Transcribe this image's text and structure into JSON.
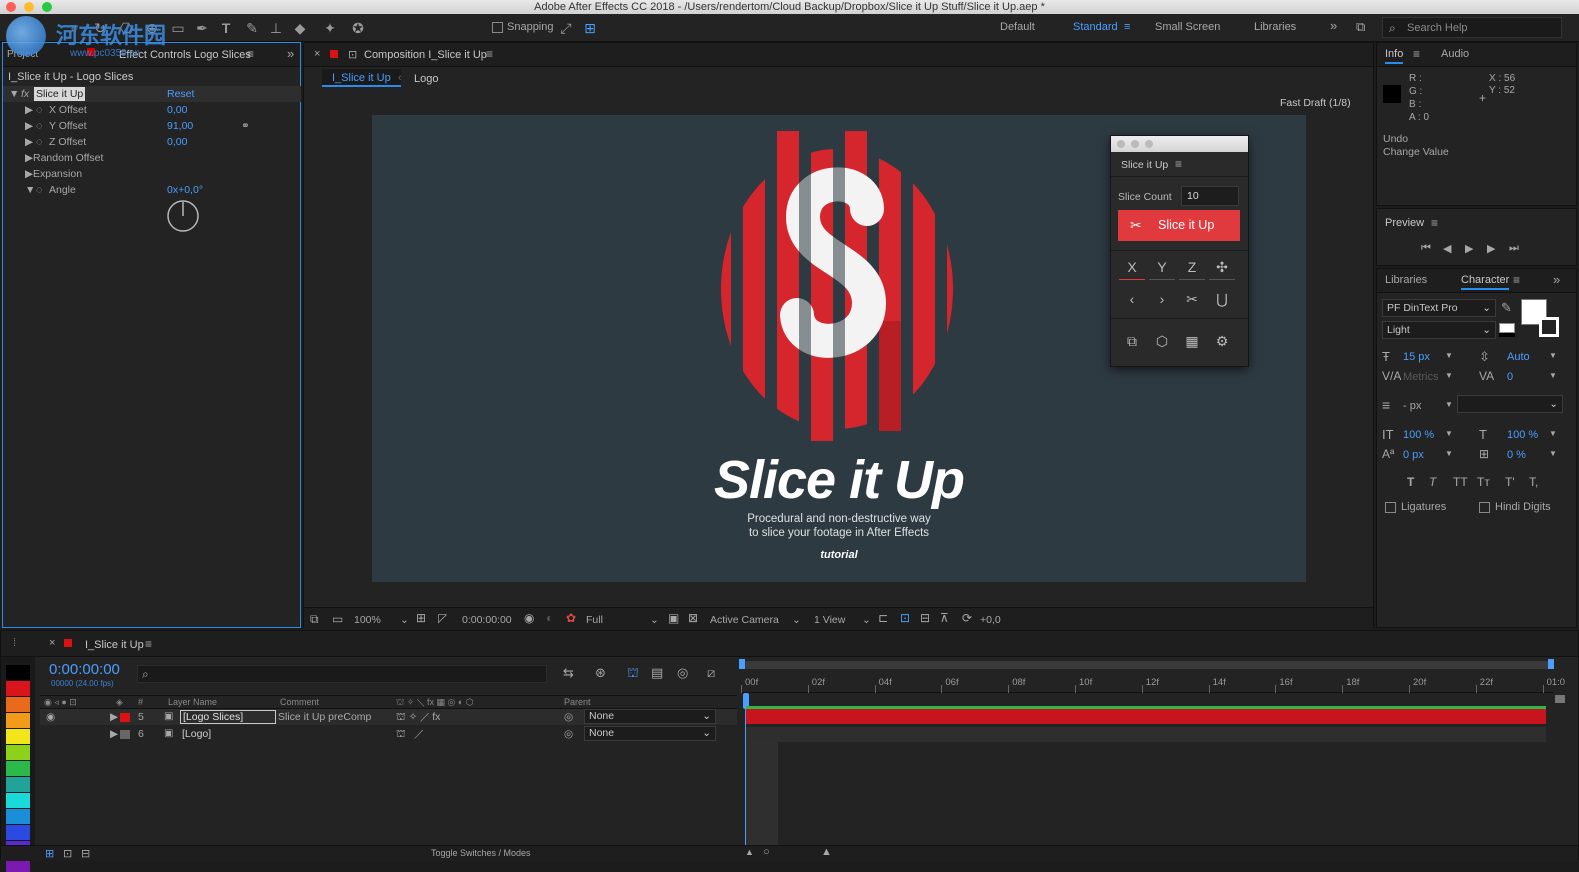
{
  "window": {
    "title": "Adobe After Effects CC 2018 - /Users/rendertom/Cloud Backup/Dropbox/Slice it Up Stuff/Slice it Up.aep *"
  },
  "watermark": {
    "text": "河东软件园",
    "sub": "www.pc0359.cn"
  },
  "toolbar": {
    "snapping_label": "Snapping",
    "workspaces": [
      "Default",
      "Standard",
      "Small Screen",
      "Libraries"
    ],
    "active_workspace": "Standard",
    "search_placeholder": "Search Help"
  },
  "project_tab": "Project",
  "effect_controls": {
    "tab_title": "Effect Controls Logo Slices",
    "layer_path": "I_Slice it Up - Logo Slices",
    "effect_name": "Slice it Up",
    "reset_label": "Reset",
    "properties": [
      {
        "name": "X Offset",
        "value": "0,00"
      },
      {
        "name": "Y Offset",
        "value": "91,00"
      },
      {
        "name": "Z Offset",
        "value": "0,00"
      },
      {
        "name": "Random Offset",
        "value": ""
      },
      {
        "name": "Expansion",
        "value": ""
      },
      {
        "name": "Angle",
        "value": "0x+0,0°"
      }
    ]
  },
  "composition": {
    "tab_title": "Composition I_Slice it Up",
    "breadcrumb": [
      "I_Slice it Up",
      "Logo"
    ],
    "render_mode": "Fast Draft (1/8)",
    "logo_title": "Slice it Up",
    "logo_subtitle_1": "Procedural and non-destructive way",
    "logo_subtitle_2": "to slice your footage in After Effects",
    "logo_tag": "tutorial",
    "footer": {
      "zoom": "100%",
      "timecode": "0:00:00:00",
      "resolution": "Full",
      "camera": "Active Camera",
      "views": "1 View",
      "exposure": "+0,0"
    }
  },
  "plugin_panel": {
    "title": "Slice it Up",
    "slice_count_label": "Slice Count",
    "slice_count_value": "10",
    "button_label": "Slice it Up",
    "axis_buttons": [
      "X",
      "Y",
      "Z",
      "✣"
    ],
    "row2_buttons": [
      "‹",
      "›",
      "✂",
      "⋃"
    ],
    "row3_icons": [
      "duplicate-icon",
      "cube-icon",
      "layers-icon",
      "gear-icon"
    ]
  },
  "info": {
    "tabs": [
      "Info",
      "Audio"
    ],
    "rgb_labels": [
      "R :",
      "G :",
      "B :",
      "A : 0"
    ],
    "x": "X : 56",
    "y": "Y : 52",
    "undo": "Undo",
    "change_value": "Change Value"
  },
  "preview": {
    "tab": "Preview"
  },
  "character": {
    "tabs": [
      "Libraries",
      "Character"
    ],
    "font_family": "PF DinText Pro",
    "font_style": "Light",
    "font_size": "15 px",
    "leading": "Auto",
    "kerning": "Metrics",
    "tracking": "0",
    "stroke": "- px",
    "vscale": "100 %",
    "hscale": "100 %",
    "baseline": "0 px",
    "tsume": "0 %",
    "styles": [
      "T",
      "T",
      "TT",
      "Tт",
      "T'",
      "T,"
    ],
    "ligatures_label": "Ligatures",
    "hindi_label": "Hindi Digits"
  },
  "timeline": {
    "tab_title": "I_Slice it Up",
    "timecode": "0:00:00:00",
    "frames_sub": "00000 (24.00 fps)",
    "columns": {
      "layer_name": "Layer Name",
      "comment": "Comment",
      "parent": "Parent"
    },
    "layers": [
      {
        "num": "5",
        "name": "[Logo Slices]",
        "comment": "Slice it Up preComp",
        "parent": "None"
      },
      {
        "num": "6",
        "name": "[Logo]",
        "comment": "",
        "parent": "None"
      }
    ],
    "ruler": [
      "00f",
      "02f",
      "04f",
      "06f",
      "08f",
      "10f",
      "12f",
      "14f",
      "16f",
      "18f",
      "20f",
      "22f",
      "01:0"
    ],
    "toggle_label": "Toggle Switches / Modes"
  },
  "colors": {
    "accent": "#4a9eff",
    "plugin_red": "#e03a3e",
    "comp_bg": "#2e3a42",
    "layer_bar": "#c9141e",
    "green_bar": "#2db84a"
  },
  "label_swatches": [
    "#000000",
    "#d9141a",
    "#e86a1a",
    "#f29a1a",
    "#f2e61a",
    "#8ed11a",
    "#2db84a",
    "#22a39a",
    "#1ad9d9",
    "#1a8ed9",
    "#2a4ae0",
    "#5a2ad0",
    "#7a1ab0"
  ]
}
